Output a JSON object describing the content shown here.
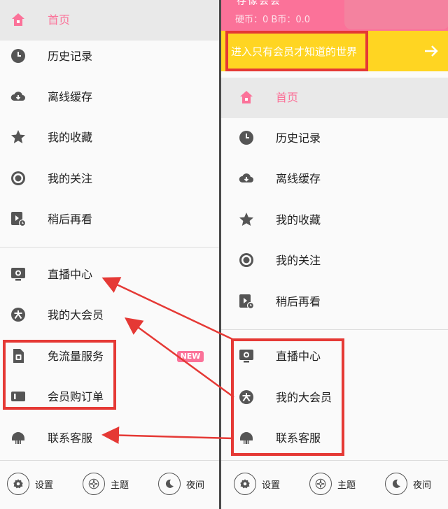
{
  "left": {
    "items": [
      {
        "label": "首页",
        "icon": "home-icon"
      },
      {
        "label": "历史记录",
        "icon": "clock-icon"
      },
      {
        "label": "离线缓存",
        "icon": "cloud-download-icon"
      },
      {
        "label": "我的收藏",
        "icon": "star-icon"
      },
      {
        "label": "我的关注",
        "icon": "target-icon"
      },
      {
        "label": "稍后再看",
        "icon": "play-later-icon"
      },
      {
        "label": "直播中心",
        "icon": "live-tv-icon"
      },
      {
        "label": "我的大会员",
        "icon": "vip-icon"
      },
      {
        "label": "免流量服务",
        "icon": "sim-card-icon"
      },
      {
        "label": "会员购订单",
        "icon": "ticket-icon"
      },
      {
        "label": "联系客服",
        "icon": "support-icon"
      }
    ],
    "new_badge": "NEW"
  },
  "right": {
    "header": {
      "username": "存像会会",
      "coins": "硬币：0   B币：0.0"
    },
    "banner": "进入只有会员才知道的世界",
    "items": [
      {
        "label": "首页",
        "icon": "home-icon"
      },
      {
        "label": "历史记录",
        "icon": "clock-icon"
      },
      {
        "label": "离线缓存",
        "icon": "cloud-download-icon"
      },
      {
        "label": "我的收藏",
        "icon": "star-icon"
      },
      {
        "label": "我的关注",
        "icon": "target-icon"
      },
      {
        "label": "稍后再看",
        "icon": "play-later-icon"
      },
      {
        "label": "直播中心",
        "icon": "live-tv-icon"
      },
      {
        "label": "我的大会员",
        "icon": "vip-icon"
      },
      {
        "label": "联系客服",
        "icon": "support-icon"
      }
    ]
  },
  "bottom": {
    "settings": "设置",
    "theme": "主题",
    "night": "夜间"
  },
  "colors": {
    "accent_pink": "#fb7299",
    "banner_yellow": "#ffd522",
    "annotation_red": "#e53935"
  }
}
